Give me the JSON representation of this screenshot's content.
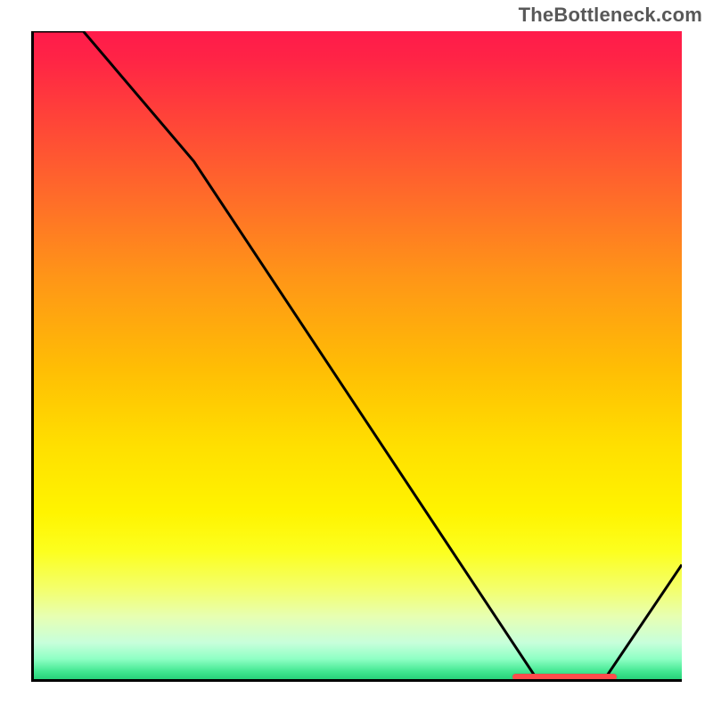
{
  "attribution": "TheBottleneck.com",
  "colors": {
    "curve_stroke": "#000000",
    "axis_color": "#000000",
    "marker_color": "#ff4b4b"
  },
  "chart_data": {
    "type": "line",
    "title": "",
    "xlabel": "",
    "ylabel": "",
    "xlim": [
      0,
      100
    ],
    "ylim": [
      0,
      100
    ],
    "x": [
      0,
      8,
      25,
      78,
      88,
      100
    ],
    "values": [
      105,
      100,
      80,
      0,
      0.2,
      18
    ],
    "marker": {
      "x_start": 74,
      "x_end": 90,
      "y": 0.8
    },
    "gradient_stops": [
      {
        "pct": 0,
        "hex": "#ff1b4b"
      },
      {
        "pct": 25,
        "hex": "#ff6a2a"
      },
      {
        "pct": 52,
        "hex": "#ffbe04"
      },
      {
        "pct": 74,
        "hex": "#fff400"
      },
      {
        "pct": 90,
        "hex": "#e7ffb3"
      },
      {
        "pct": 100,
        "hex": "#1fca72"
      }
    ]
  }
}
